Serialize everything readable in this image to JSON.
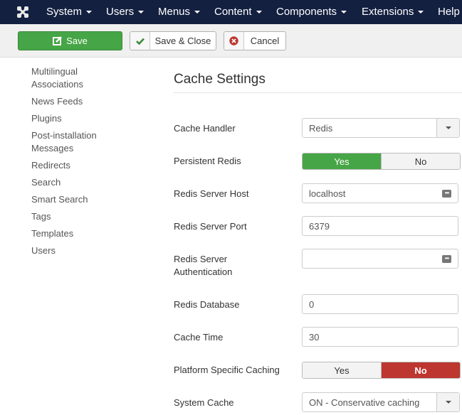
{
  "navbar": {
    "logo": "joomla-logo",
    "menus": [
      {
        "label": "System"
      },
      {
        "label": "Users"
      },
      {
        "label": "Menus"
      },
      {
        "label": "Content"
      },
      {
        "label": "Components"
      },
      {
        "label": "Extensions"
      },
      {
        "label": "Help"
      }
    ]
  },
  "toolbar": {
    "save_label": "Save",
    "save_close_label": "Save & Close",
    "cancel_label": "Cancel",
    "colors": {
      "save": "#46a546",
      "check": "#3b8a3b",
      "cancel_icon": "#bd362f"
    }
  },
  "sidebar": {
    "items": [
      {
        "label": "Multilingual Associations"
      },
      {
        "label": "News Feeds"
      },
      {
        "label": "Plugins"
      },
      {
        "label": "Post-installation Messages"
      },
      {
        "label": "Redirects"
      },
      {
        "label": "Search"
      },
      {
        "label": "Smart Search"
      },
      {
        "label": "Tags"
      },
      {
        "label": "Templates"
      },
      {
        "label": "Users"
      }
    ]
  },
  "section": {
    "title": "Cache Settings",
    "fields": {
      "cache_handler": {
        "label": "Cache Handler",
        "value": "Redis"
      },
      "persistent_redis": {
        "label": "Persistent Redis",
        "yes": "Yes",
        "no": "No",
        "selected": "Yes"
      },
      "redis_host": {
        "label": "Redis Server Host",
        "value": "localhost"
      },
      "redis_port": {
        "label": "Redis Server Port",
        "value": "6379"
      },
      "redis_auth": {
        "label": "Redis Server Authentication",
        "value": ""
      },
      "redis_db": {
        "label": "Redis Database",
        "value": "0"
      },
      "cache_time": {
        "label": "Cache Time",
        "value": "30"
      },
      "platform_caching": {
        "label": "Platform Specific Caching",
        "yes": "Yes",
        "no": "No",
        "selected": "No"
      },
      "system_cache": {
        "label": "System Cache",
        "value": "ON - Conservative caching"
      }
    }
  }
}
